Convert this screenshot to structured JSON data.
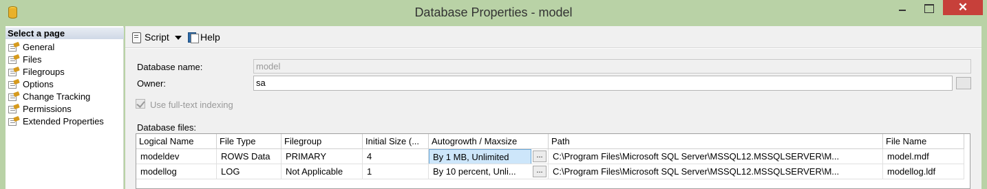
{
  "window": {
    "title": "Database Properties - model",
    "close_glyph": "✕"
  },
  "left_pane": {
    "header": "Select a page",
    "items": [
      {
        "label": "General"
      },
      {
        "label": "Files"
      },
      {
        "label": "Filegroups"
      },
      {
        "label": "Options"
      },
      {
        "label": "Change Tracking"
      },
      {
        "label": "Permissions"
      },
      {
        "label": "Extended Properties"
      }
    ]
  },
  "toolbar": {
    "script_label": "Script",
    "help_label": "Help"
  },
  "form": {
    "db_name_label": "Database name:",
    "db_name_value": "model",
    "owner_label": "Owner:",
    "owner_value": "sa",
    "fulltext_label": "Use full-text indexing",
    "fulltext_checked": true,
    "db_files_label": "Database files:"
  },
  "grid": {
    "columns": [
      "Logical Name",
      "File Type",
      "Filegroup",
      "Initial Size (...",
      "Autogrowth / Maxsize",
      "Path",
      "File Name"
    ],
    "rows": [
      [
        "modeldev",
        "ROWS Data",
        "PRIMARY",
        "4",
        "By 1 MB, Unlimited",
        "C:\\Program Files\\Microsoft SQL Server\\MSSQL12.MSSQLSERVER\\M...",
        "model.mdf"
      ],
      [
        "modellog",
        "LOG",
        "Not Applicable",
        "1",
        "By 10 percent, Unli...",
        "C:\\Program Files\\Microsoft SQL Server\\MSSQL12.MSSQLSERVER\\M...",
        "modellog.ldf"
      ]
    ],
    "ellipsis": "..."
  },
  "colors": {
    "titlebar": "#b9d2a6",
    "close_button": "#c7403a",
    "selected_cell": "#cde6fa"
  }
}
